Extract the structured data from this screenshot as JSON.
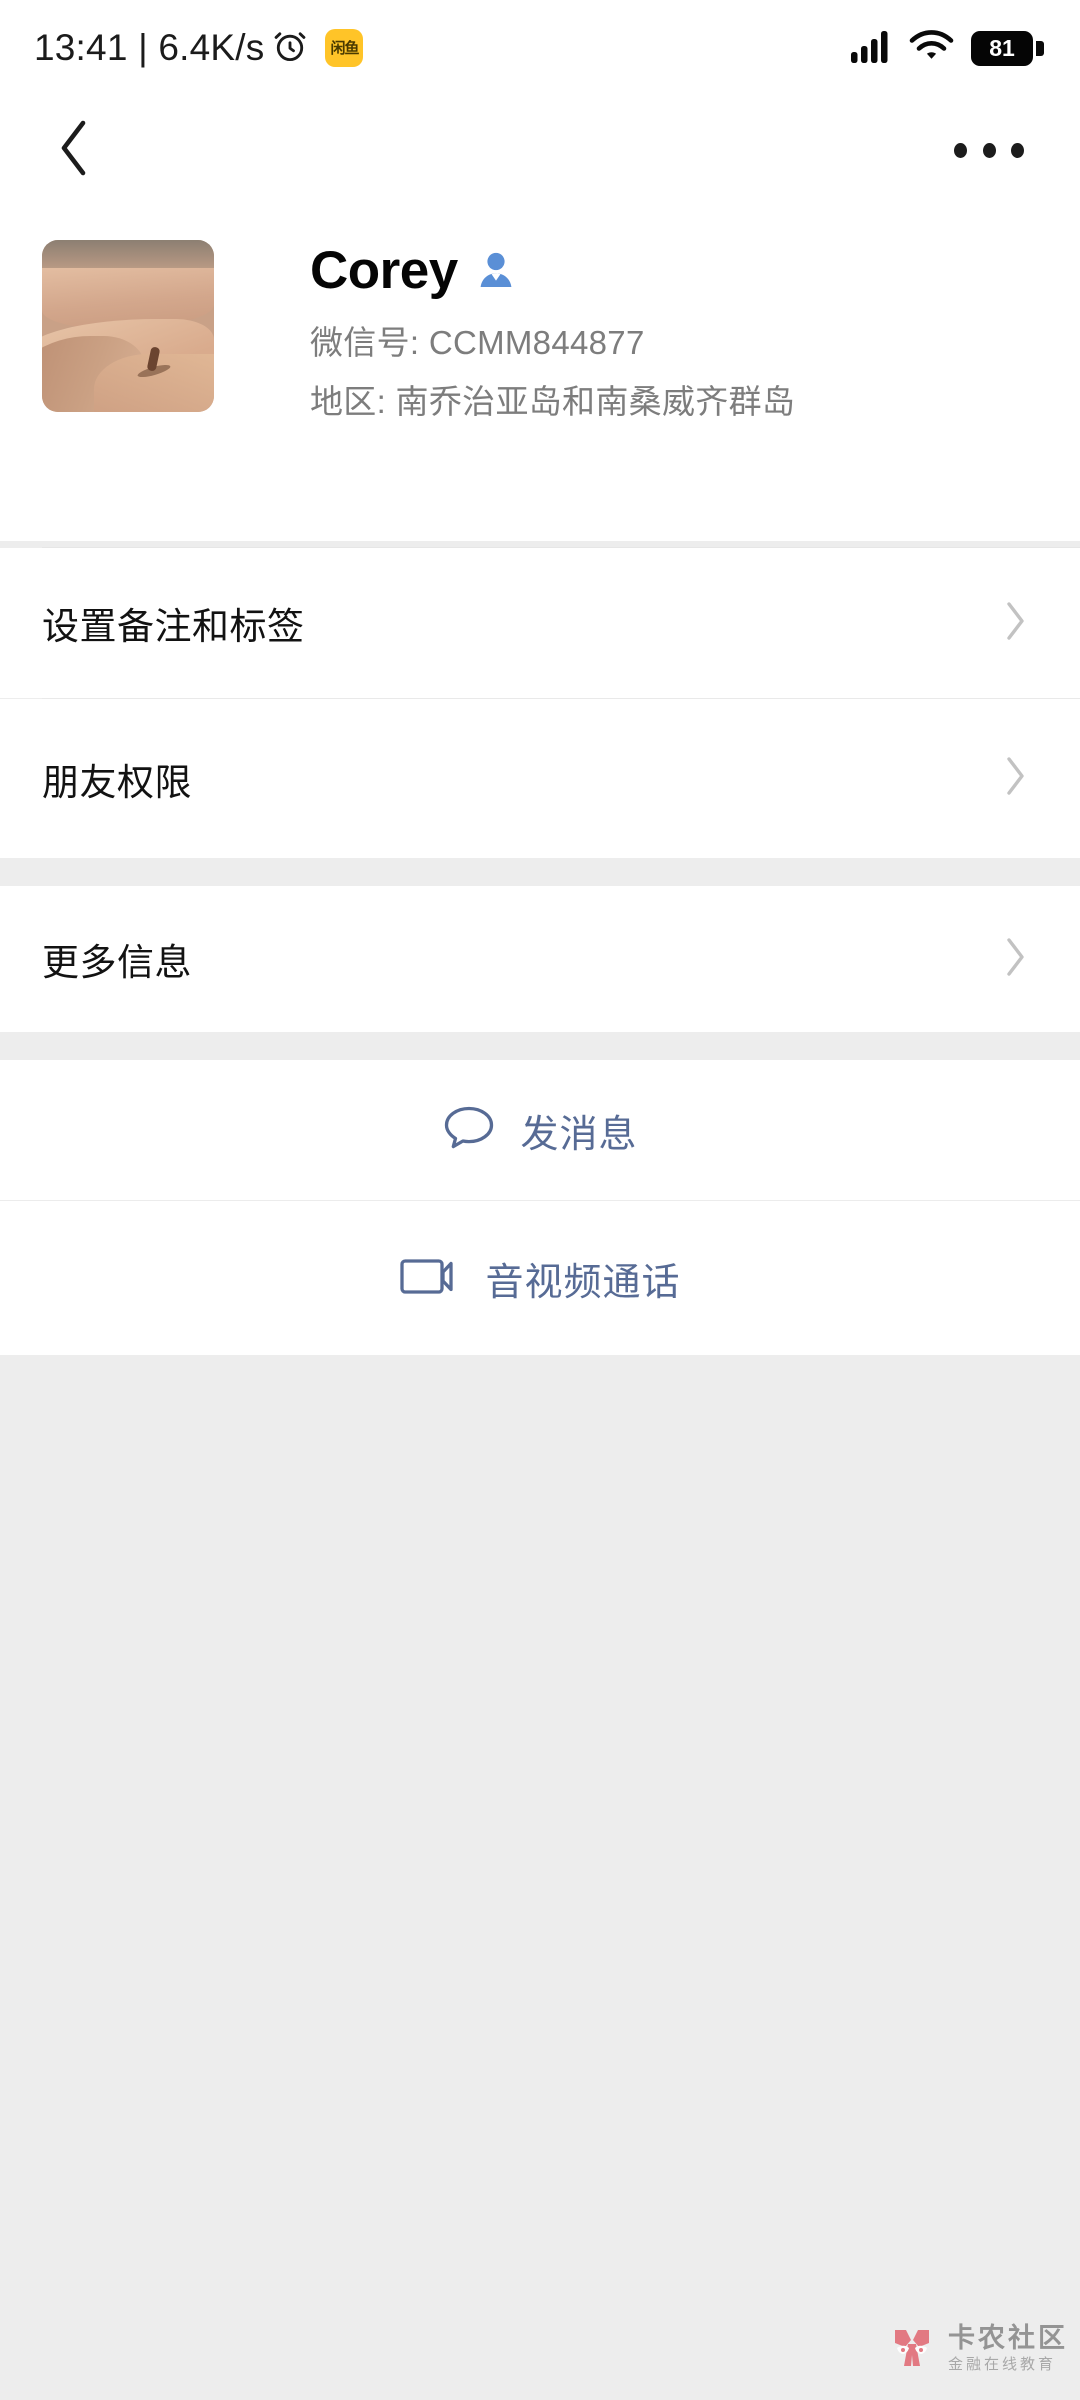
{
  "status_bar": {
    "clock_and_speed": "13:41 | 6.4K/s",
    "alarm_icon": "alarm-clock-icon",
    "app_badge_label": "闲鱼",
    "signal_icon": "cellular-signal-icon",
    "wifi_icon": "wifi-icon",
    "battery_level": "81",
    "battery_icon": "battery-icon"
  },
  "nav_bar": {
    "back_icon": "chevron-left-icon",
    "more_icon": "more-options-icon"
  },
  "profile": {
    "avatar_icon": "avatar-desert-photo",
    "name": "Corey",
    "gender_icon": "male-gender-icon",
    "wechat_id_label": "微信号:",
    "wechat_id_value": "CCMM844877",
    "region_label": "地区:",
    "region_value": "南乔治亚岛和南桑威齐群岛"
  },
  "menu": {
    "rows": [
      {
        "label": "设置备注和标签",
        "chevron_icon": "chevron-right-icon"
      },
      {
        "label": "朋友权限",
        "chevron_icon": "chevron-right-icon"
      },
      {
        "label": "更多信息",
        "chevron_icon": "chevron-right-icon"
      }
    ]
  },
  "actions": [
    {
      "label": "发消息",
      "icon": "message-bubble-icon"
    },
    {
      "label": "音视频通话",
      "icon": "video-camera-icon"
    }
  ],
  "watermark": {
    "title": "卡农社区",
    "subtitle": "金融在线教育",
    "logo_icon": "kanong-logo-icon"
  },
  "colors": {
    "accent_link": "#576b95",
    "page_background": "#ededed",
    "card_background": "#ffffff",
    "primary_text": "#050505",
    "secondary_text": "#7d7d7d",
    "badge_yellow": "#ffc428",
    "gender_blue": "#5a8fd6"
  }
}
